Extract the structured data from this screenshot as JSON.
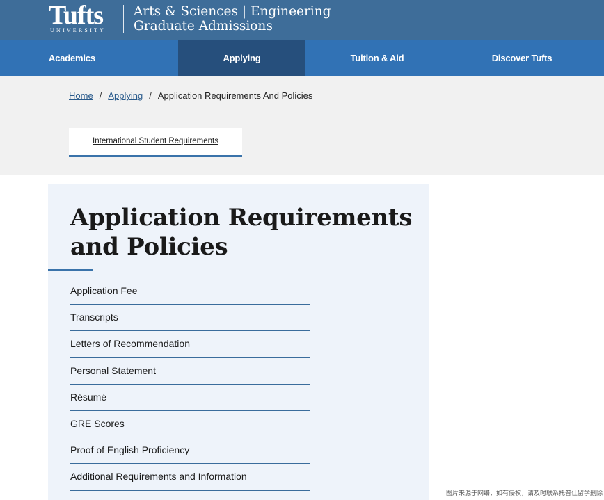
{
  "header": {
    "logo_main": "Tufts",
    "logo_sub": "UNIVERSITY",
    "title_line1": "Arts & Sciences | Engineering",
    "title_line2": "Graduate Admissions"
  },
  "nav": {
    "items": [
      {
        "label": "Academics"
      },
      {
        "label": "Applying"
      },
      {
        "label": "Tuition & Aid"
      },
      {
        "label": "Discover Tufts"
      }
    ],
    "active": "Applying"
  },
  "breadcrumb": {
    "home": "Home",
    "applying": "Applying",
    "current": "Application Requirements And Policies",
    "separator": "/"
  },
  "subnav": {
    "link": "International Student Requirements"
  },
  "main": {
    "title": "Application Requirements and Policies",
    "requirements": [
      "Application Fee",
      "Transcripts",
      "Letters of Recommendation",
      "Personal Statement",
      "Résumé",
      "GRE Scores",
      "Proof of English Proficiency",
      "Additional Requirements and Information"
    ]
  },
  "watermark": "图片来源于网络，如有侵权，请及时联系托普仕留学删除",
  "colors": {
    "header_bg": "#3e6d99",
    "nav_bg": "#3172b5",
    "nav_active": "#264f7c",
    "accent": "#3a73aa",
    "panel_bg": "#eef3fa"
  }
}
